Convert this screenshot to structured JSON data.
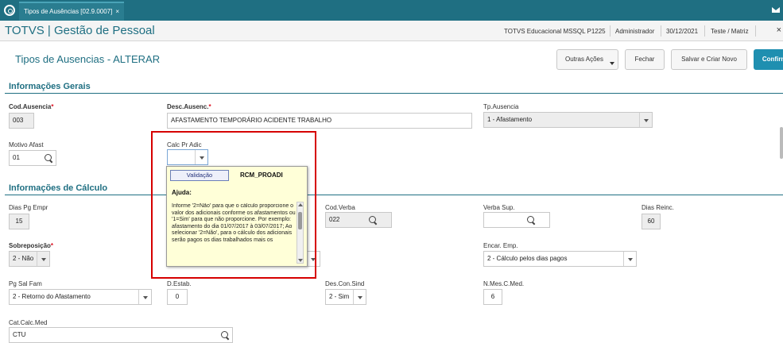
{
  "tabbar": {
    "tab_label": "Tipos de Ausências [02.9.0007]",
    "tab_close": "×"
  },
  "header": {
    "brand": "TOTVS | Gestão de Pessoal",
    "company": "TOTVS Educacional MSSQL P1225",
    "user": "Administrador",
    "date": "30/12/2021",
    "branch": "Teste / Matriz",
    "close": "×"
  },
  "page": {
    "title": "Tipos de Ausencias - ALTERAR",
    "buttons": {
      "outras": "Outras Ações",
      "fechar": "Fechar",
      "salvar_criar": "Salvar e Criar Novo",
      "confirmar": "Confirmar"
    }
  },
  "sections": {
    "gerais": "Informações Gerais",
    "calculo": "Informações de Cálculo"
  },
  "fields": {
    "cod_ausencia": {
      "label": "Cod.Ausencia",
      "value": "003"
    },
    "desc_ausenc": {
      "label": "Desc.Ausenc.",
      "value": "AFASTAMENTO TEMPORÁRIO ACIDENTE TRABALHO"
    },
    "tp_ausencia": {
      "label": "Tp.Ausencia",
      "value": "1 - Afastamento"
    },
    "motivo_afast": {
      "label": "Motivo Afast",
      "value": "01"
    },
    "calc_pr_adic": {
      "label": "Calc Pr Adic",
      "value": ""
    },
    "dias_pg_empr": {
      "label": "Dias Pg Empr",
      "value": "15"
    },
    "cod_verba": {
      "label": "Cod.Verba",
      "value": "022"
    },
    "verba_sup": {
      "label": "Verba Sup.",
      "value": ""
    },
    "dias_reinc": {
      "label": "Dias Reinc.",
      "value": "60"
    },
    "sobreposicao": {
      "label": "Sobreposição",
      "value": "2 - Não"
    },
    "encar_emp": {
      "label": "Encar. Emp.",
      "value": "2 - Cálculo pelos dias pagos"
    },
    "pg_sal_fam": {
      "label": "Pg Sal Fam",
      "value": "2 - Retorno do Afastamento"
    },
    "d_estab": {
      "label": "D.Estab.",
      "value": "0"
    },
    "des_con_sind": {
      "label": "Des.Con.Sind",
      "value": "2 - Sim"
    },
    "n_mes_c_med": {
      "label": "N.Mes.C.Med.",
      "value": "6"
    },
    "cat_calc_med": {
      "label": "Cat.Calc.Med",
      "value": "CTU"
    }
  },
  "help": {
    "button": "Validação",
    "code": "RCM_PROADI",
    "title": "Ajuda:",
    "text": "Informe '2=Não' para que o cálculo proporcione o valor dos adicionais conforme os afastamentos ou '1=Sim' para que não proporcione. Por exemplo: afastamento do dia 01/07/2017 à 03/07/2017; Ao selecionar '2=Não', para o cálculo dos adicionais serão pagos os dias trabalhados mais os"
  },
  "icons": [
    "logo-icon",
    "mail-icon",
    "search-icon",
    "chevron-down-icon",
    "close-icon"
  ]
}
